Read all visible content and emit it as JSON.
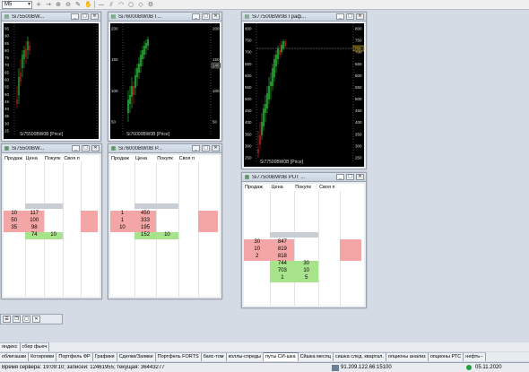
{
  "toolbar": {
    "timeframe": "M5"
  },
  "windows": [
    {
      "id": "w1",
      "title": "Si75500BW...",
      "legend": "Si75500BW0B [Price]",
      "y_ticks": [
        "95",
        "90",
        "85",
        "80",
        "75",
        "70",
        "65",
        "60",
        "55",
        "50",
        "45",
        "40",
        "35",
        "30",
        "25"
      ],
      "book_headers": [
        "Продаж",
        "Цена",
        "Покупк",
        "Своя п"
      ],
      "sell_rows": [
        [
          "10",
          "117"
        ],
        [
          "50",
          "100"
        ],
        [
          "35",
          "98"
        ]
      ],
      "buy_rows": [
        [
          "74",
          "10"
        ]
      ]
    },
    {
      "id": "w2",
      "title": "Si76000BW0B Г...",
      "legend": "Si76000BW0B [Price]",
      "y_ticks": [
        "200",
        "150",
        "100",
        "50"
      ],
      "right_ticks": [
        "200",
        "150",
        "100",
        "50"
      ],
      "last_price_tag": "140",
      "book_title": "Si76000BW0B P...",
      "book_headers": [
        "Продаж",
        "Цена",
        "Покупк",
        "Своя п"
      ],
      "sell_rows": [
        [
          "1",
          "450"
        ],
        [
          "1",
          "333"
        ],
        [
          "10",
          "195"
        ]
      ],
      "buy_rows": [
        [
          "152",
          "10"
        ]
      ]
    },
    {
      "id": "w3",
      "title": "Si77500BW0B Граф...",
      "legend": "Si77500BW0B [Price]",
      "y_ticks": [
        "800",
        "750",
        "700",
        "650",
        "600",
        "550",
        "500",
        "450",
        "400",
        "350",
        "300",
        "250"
      ],
      "right_ticks": [
        "800",
        "750",
        "700",
        "650",
        "600",
        "550",
        "500",
        "450",
        "400",
        "350",
        "300",
        "250"
      ],
      "last_price_tag": "750",
      "book_title": "Si77500BW0B PUT ...",
      "book_headers": [
        "Продаж",
        "Цена",
        "Покупк",
        "Своя п"
      ],
      "sell_rows": [
        [
          "30",
          "847"
        ],
        [
          "10",
          "819"
        ],
        [
          "2",
          "818"
        ]
      ],
      "buy_rows": [
        [
          "744",
          "30"
        ],
        [
          "703",
          "10"
        ],
        [
          "1",
          "5"
        ]
      ]
    }
  ],
  "book1_title": "Si75500BW...",
  "tabs_row1": [
    "яндекс",
    "сбер фьюч"
  ],
  "tabs_row2": [
    "облигашки",
    "Котировки",
    "Портфель ФР",
    "Графики",
    "Сделки/Заявки",
    "Портфель FORTS",
    "баяс-том",
    "коллы-спреды",
    "путы СИ-шка",
    "Сйшка месяц",
    "сишка след. квартал.",
    "опционы анализ",
    "опционы РТС",
    "нефть--"
  ],
  "active_tab": "путы СИ-шка",
  "status": {
    "server_time": "Время сервера: 19:09:10; записей: 12461955; текущая: 36443277",
    "connection": "91.209.122.66:15100",
    "date": "05.11.2020"
  },
  "colors": {
    "sell": "#f4a6a6",
    "buy": "#a6e38a",
    "candle_up": "#2ecc40",
    "candle_down": "#d62020"
  }
}
